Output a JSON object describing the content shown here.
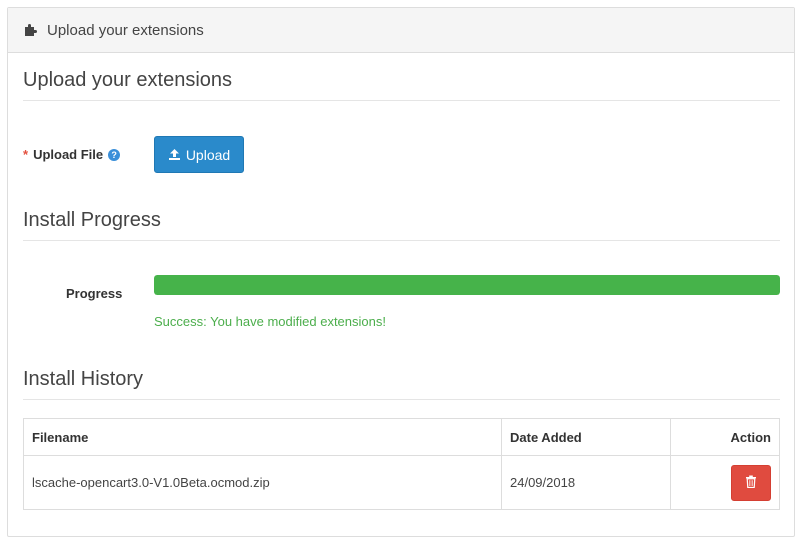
{
  "panel": {
    "heading": "Upload your extensions",
    "heading_icon": "puzzle-piece-icon"
  },
  "upload_section": {
    "title": "Upload your extensions",
    "field_required_mark": "*",
    "field_label": "Upload File",
    "help_icon_glyph": "?",
    "upload_button_label": "Upload",
    "upload_button_icon": "upload-icon"
  },
  "progress_section": {
    "title": "Install Progress",
    "label": "Progress",
    "progress_fraction": 1.0,
    "status_text": "Success: You have modified extensions!",
    "status_color": "#4cae4c"
  },
  "history_section": {
    "title": "Install History",
    "columns": [
      "Filename",
      "Date Added",
      "Action"
    ],
    "rows": [
      {
        "filename": "lscache-opencart3.0-V1.0Beta.ocmod.zip",
        "date_added": "24/09/2018",
        "action_icon": "trash-icon"
      }
    ]
  },
  "colors": {
    "primary": "#2a8acb",
    "success": "#46b34a",
    "danger": "#e04b3f",
    "required": "#e3503e"
  }
}
